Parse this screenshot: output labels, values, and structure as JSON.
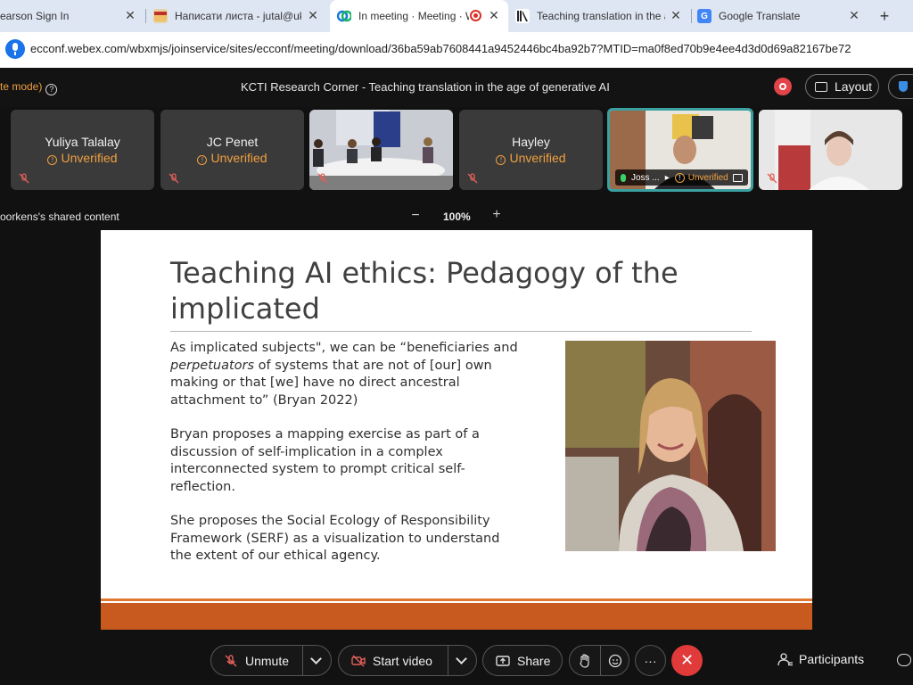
{
  "browser": {
    "tabs": [
      {
        "label": "earson Sign In",
        "icon": "pearson-icon"
      },
      {
        "label": "Написати листа - jutal@ukr.n",
        "icon": "ukrnet-mail-icon"
      },
      {
        "label": "In meeting · Meeting · We",
        "icon": "webex-icon",
        "active": true
      },
      {
        "label": "Teaching translation in the ag",
        "icon": "kcti-icon"
      },
      {
        "label": "Google Translate",
        "icon": "google-translate-icon"
      }
    ],
    "url": "ecconf.webex.com/wbxmjs/joinservice/sites/ecconf/meeting/download/36ba59ab7608441a9452446bc4ba92b7?MTID=ma0f8ed70b9e4ee4d3d0d69a82167be72"
  },
  "meeting": {
    "mode_label": "te mode)",
    "title": "KCTI Research Corner - Teaching translation in the age of generative AI",
    "layout_label": "Layout",
    "recording_color": "#e24449"
  },
  "participants": [
    {
      "name": "Yuliya Talalay",
      "status": "Unverified",
      "video": false
    },
    {
      "name": "JC Penet",
      "status": "Unverified",
      "video": false
    },
    {
      "name": "",
      "status": "",
      "video": true
    },
    {
      "name": "Hayley",
      "status": "Unverified",
      "video": false
    },
    {
      "name": "Joss ...",
      "status": "Unverified",
      "video": true,
      "active_speaker": true
    },
    {
      "name": "",
      "status": "",
      "video": true
    }
  ],
  "share": {
    "label": "oorkens's shared content",
    "zoom": "100%"
  },
  "slide": {
    "title": "Teaching AI ethics: Pedagogy of the implicated",
    "paragraphs": [
      {
        "pre": "As implicated subjects\", we can be “beneficiaries and ",
        "em": "perpetuators",
        "post": " of systems that are not of [our] own making or that [we] have no direct ancestral attachment to” (Bryan 2022)"
      },
      {
        "pre": "Bryan proposes a mapping exercise as part of a discussion of self-implication in a complex interconnected system to prompt critical self-reflection.",
        "em": "",
        "post": ""
      },
      {
        "pre": "She proposes the Social Ecology of Responsibility Framework (SERF) as a visualization to understand the extent of our ethical agency.",
        "em": "",
        "post": ""
      }
    ],
    "accent_color": "#c95a1f"
  },
  "controls": {
    "unmute_label": "Unmute",
    "video_label": "Start video",
    "share_label": "Share",
    "participants_label": "Participants"
  }
}
